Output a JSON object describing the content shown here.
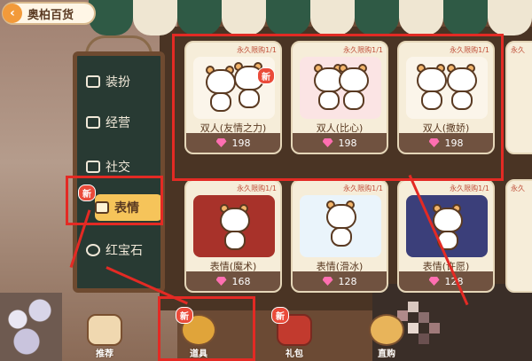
{
  "header": {
    "title": "奥柏百货",
    "back_icon": "chevron-left-icon"
  },
  "sidebar": {
    "items": [
      {
        "label": "装扮",
        "icon": "wardrobe-icon"
      },
      {
        "label": "经营",
        "icon": "shop-icon"
      },
      {
        "label": "社交",
        "icon": "chat-icon"
      },
      {
        "label": "表情",
        "icon": "cat-face-icon",
        "active": true,
        "badge": "新"
      },
      {
        "label": "红宝石",
        "icon": "gem-icon"
      }
    ]
  },
  "cards": [
    {
      "tag": "永久限购1/1",
      "name": "双人(友情之力)",
      "price": "198",
      "badge": "新"
    },
    {
      "tag": "永久限购1/1",
      "name": "双人(比心)",
      "price": "198"
    },
    {
      "tag": "永久限购1/1",
      "name": "双人(撒娇)",
      "price": "198"
    },
    {
      "tag": "永久限购1/1",
      "name": "表情(魔术)",
      "price": "168"
    },
    {
      "tag": "永久限购1/1",
      "name": "表情(滑冰)",
      "price": "128"
    },
    {
      "tag": "永久限购1/1",
      "name": "表情(许愿)",
      "price": "128"
    }
  ],
  "partial_cards": [
    {
      "tag": "永久"
    },
    {
      "tag": "永久"
    }
  ],
  "bottom_bar": [
    {
      "label": "推荐",
      "badge": ""
    },
    {
      "label": "道具",
      "badge": "新"
    },
    {
      "label": "礼包",
      "badge": "新"
    },
    {
      "label": "直购",
      "badge": ""
    }
  ],
  "colors": {
    "highlight": "#e32a24",
    "gem": "#ff6fb1",
    "active_tab": "#f6c45a"
  }
}
